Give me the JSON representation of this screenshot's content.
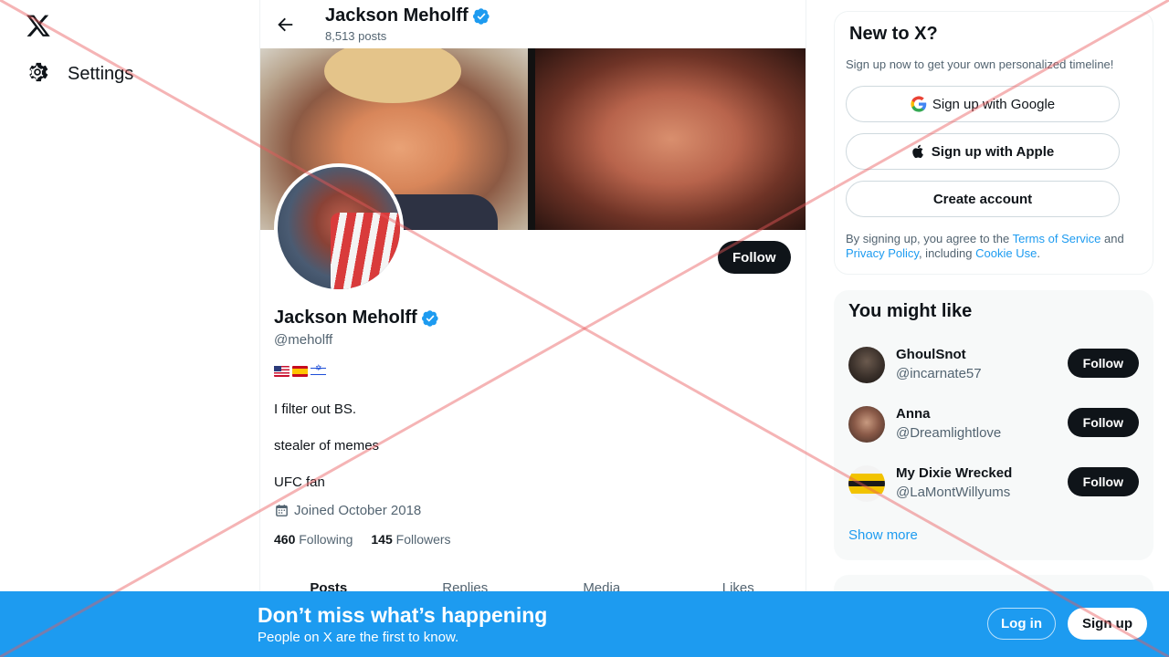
{
  "nav": {
    "logo_icon": "x-logo-icon",
    "settings_label": "Settings",
    "settings_icon": "gear-icon"
  },
  "header": {
    "name": "Jackson Meholff",
    "posts": "8,513 posts",
    "back_icon": "arrow-left-icon"
  },
  "profile": {
    "name": "Jackson Meholff",
    "handle": "@meholff",
    "verified": true,
    "flags": [
      "us-flag",
      "spain-flag",
      "israel-flag"
    ],
    "bio": [
      "I filter out BS.",
      "stealer of memes",
      "UFC fan"
    ],
    "joined": "Joined October 2018",
    "following_count": "460",
    "following_label": "Following",
    "followers_count": "145",
    "followers_label": "Followers",
    "follow_label": "Follow"
  },
  "tabs": [
    {
      "label": "Posts",
      "active": true
    },
    {
      "label": "Replies",
      "active": false
    },
    {
      "label": "Media",
      "active": false
    },
    {
      "label": "Likes",
      "active": false
    }
  ],
  "new_to_x": {
    "title": "New to X?",
    "subtitle": "Sign up now to get your own personalized timeline!",
    "google_label": "Sign up with Google",
    "apple_label": "Sign up with Apple",
    "create_label": "Create account",
    "terms_prefix": "By signing up, you agree to the ",
    "terms_link": "Terms of Service",
    "terms_and": " and",
    "privacy_link": "Privacy Policy",
    "including": ", including ",
    "cookie_link": "Cookie Use",
    "end": "."
  },
  "you_might_like": {
    "title": "You might like",
    "users": [
      {
        "name": "GhoulSnot",
        "handle": "@incarnate57",
        "follow_label": "Follow"
      },
      {
        "name": "Anna",
        "handle": "@Dreamlightlove",
        "follow_label": "Follow"
      },
      {
        "name": "My Dixie Wrecked",
        "handle": "@LaMontWillyums",
        "follow_label": "Follow"
      }
    ],
    "show_more": "Show more"
  },
  "bottom_banner": {
    "title": "Don’t miss what’s happening",
    "subtitle": "People on X are the first to know.",
    "login_label": "Log in",
    "signup_label": "Sign up"
  },
  "colors": {
    "accent": "#1d9bf0",
    "text": "#0f1419",
    "muted": "#536471",
    "overlay_x": "#e8585c"
  }
}
